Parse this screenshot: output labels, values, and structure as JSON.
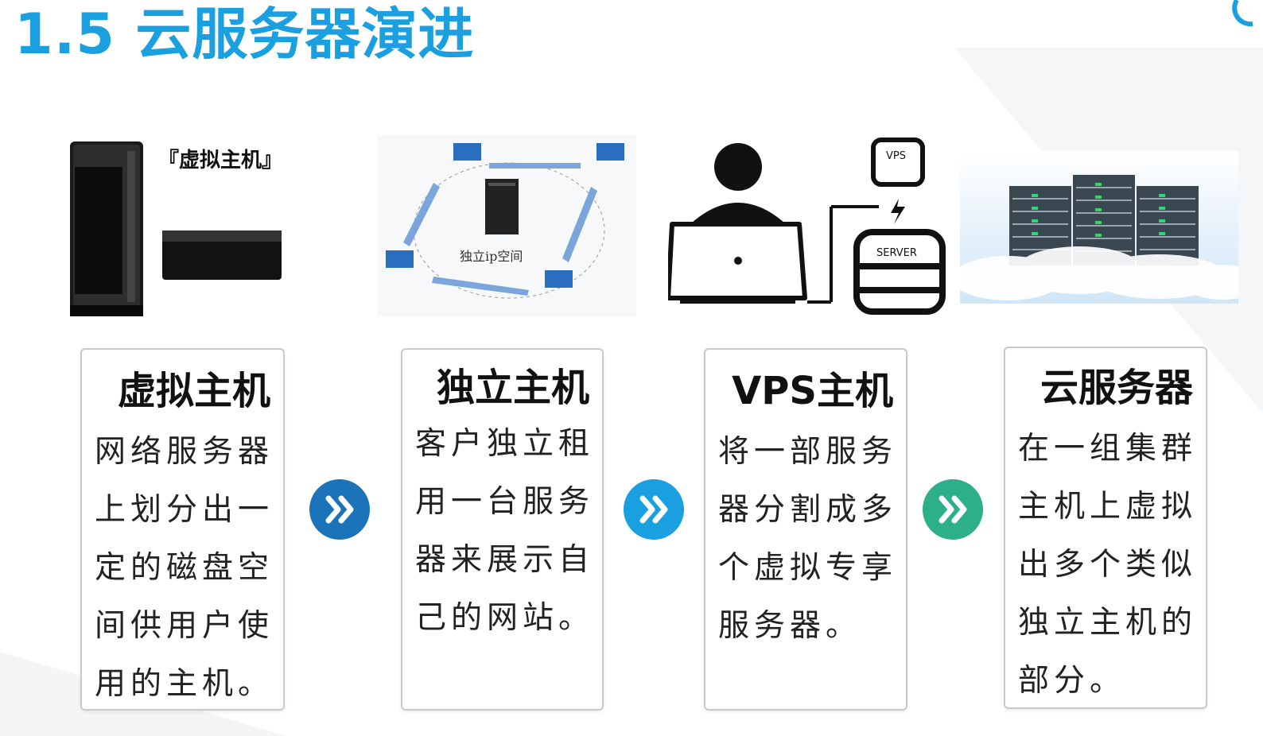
{
  "title": "1.5 云服务器演进",
  "colors": {
    "title": "#1a9fe0",
    "arrow1": "#1b73b9",
    "arrow2": "#1a9fe0",
    "arrow3": "#2bb08a"
  },
  "images": {
    "virtual_host_caption": "『虚拟主机』",
    "dedicated_caption": "独立ip空间",
    "vps_badge": "VPS",
    "server_badge": "SERVER"
  },
  "cards": [
    {
      "title": "虚拟主机",
      "lines": [
        "网络服务器",
        "上划分出一",
        "定的磁盘空",
        "间供用户使",
        "用的主机。"
      ]
    },
    {
      "title": "独立主机",
      "lines": [
        "客户独立租",
        "用一台服务",
        "器来展示自",
        "己的网站。"
      ]
    },
    {
      "title": "VPS主机",
      "lines": [
        "将一部服务",
        "器分割成多",
        "个虚拟专享",
        "服务器。"
      ]
    },
    {
      "title": "云服务器",
      "lines": [
        "在一组集群",
        "主机上虚拟",
        "出多个类似",
        "独立主机的",
        "部分。"
      ]
    }
  ],
  "icons": [
    "double-chevron-right-icon",
    "double-chevron-right-icon",
    "double-chevron-right-icon"
  ]
}
